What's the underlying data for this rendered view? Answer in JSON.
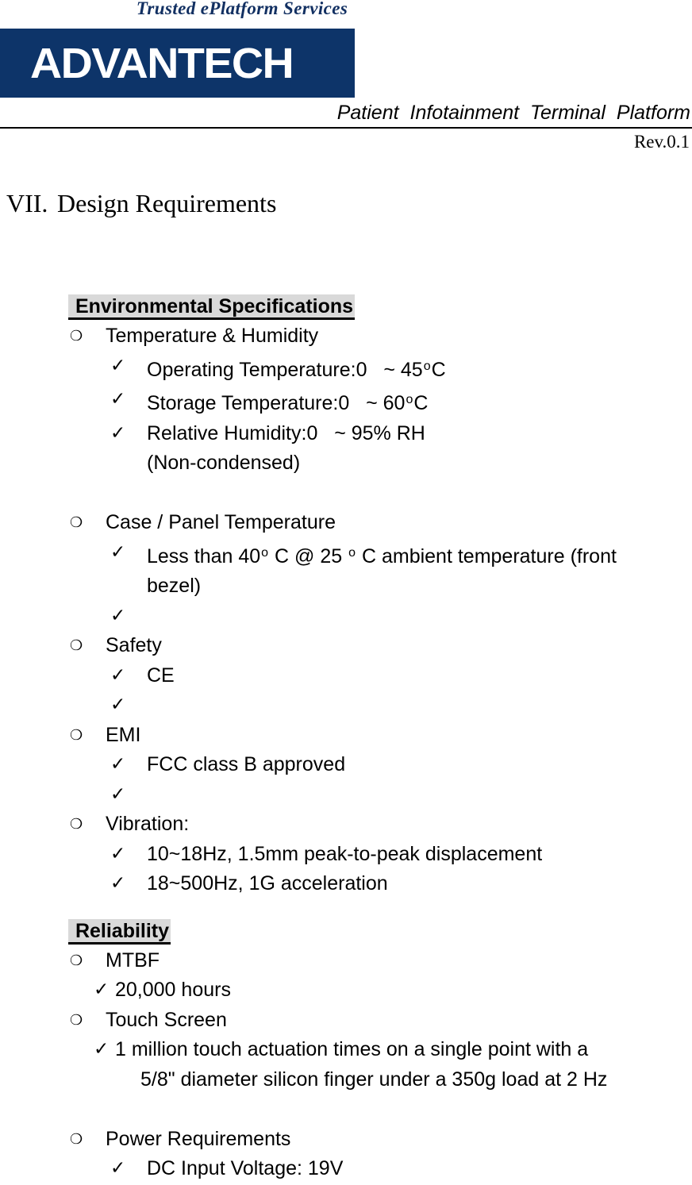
{
  "header": {
    "tagline": "Trusted ePlatform Services",
    "logo_wordmark": "ADVANTECH",
    "logo_color": "#0d3469",
    "document_title": "Patient Infotainment Terminal Platform",
    "revision": "Rev.0.1"
  },
  "chapter": {
    "number": "VII.",
    "title": "Design Requirements"
  },
  "sections": {
    "environmental": {
      "heading": "Environmental Specifications",
      "items": {
        "temp_humidity": {
          "label": "Temperature & Humidity",
          "rows": [
            {
              "name": "Operating Temperature:",
              "low": "0",
              "range": "~ 45",
              "unit": "C",
              "degree": "o"
            },
            {
              "name": "Storage Temperature:",
              "low": "0",
              "range": "~ 60",
              "unit": "C",
              "degree": "o"
            },
            {
              "name": "Relative Humidity:",
              "low": "0",
              "range": "~ 95% RH",
              "unit": "",
              "degree": ""
            }
          ],
          "note": "(Non-condensed)"
        },
        "case_panel": {
          "label": "Case / Panel Temperature",
          "detail_a": "Less than 40",
          "detail_b": " C @ 25 ",
          "detail_c": " C ambient temperature (front",
          "detail_cont": "bezel)",
          "degree": "o",
          "empty_item": ""
        },
        "safety": {
          "label": "Safety",
          "detail": "CE",
          "empty_item": ""
        },
        "emi": {
          "label": "EMI",
          "detail": "FCC class B approved",
          "empty_item": ""
        },
        "vibration": {
          "label": "Vibration:",
          "detail_1": "10~18Hz, 1.5mm peak-to-peak displacement",
          "detail_2": "18~500Hz, 1G acceleration"
        }
      }
    },
    "reliability": {
      "heading": "Reliability",
      "items": {
        "mtbf": {
          "label": "MTBF",
          "detail": "20,000 hours"
        },
        "touch_screen": {
          "label": "Touch Screen",
          "detail_line1": "1 million touch actuation times on a single point with a",
          "detail_line2": "5/8\" diameter silicon finger under a 350g load at 2 Hz"
        },
        "power": {
          "label": "Power Requirements",
          "detail": "DC Input Voltage: 19V"
        }
      }
    }
  },
  "glyphs": {
    "bullet": "❍",
    "check": "✓"
  },
  "colors": {
    "highlight": "#d9d9d9",
    "brand_navy": "#0d3469",
    "tagline_navy": "#123062"
  }
}
